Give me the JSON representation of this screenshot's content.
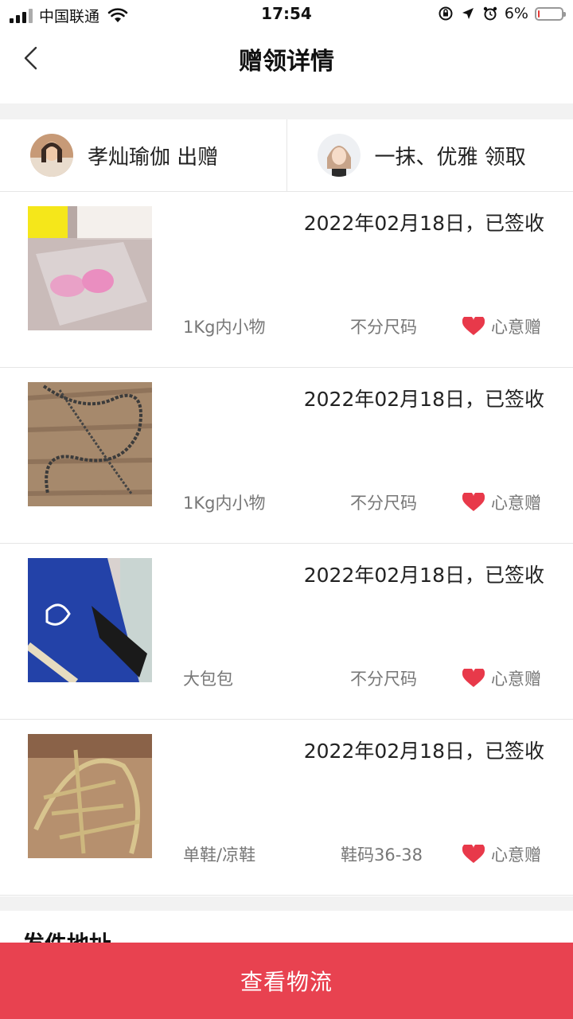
{
  "status_bar": {
    "carrier": "中国联通",
    "time": "17:54",
    "battery_percent": "6%",
    "battery_level": 0.06
  },
  "nav": {
    "title": "赠领详情",
    "back_icon": "chevron-left-icon"
  },
  "giver": {
    "name": "孝灿瑜伽 出赠"
  },
  "receiver": {
    "name": "一抹、优雅 领取"
  },
  "items": [
    {
      "date_status": "2022年02月18日，已签收",
      "weight": "1Kg内小物",
      "size": "不分尺码",
      "gift_type": "心意赠"
    },
    {
      "date_status": "2022年02月18日，已签收",
      "weight": "1Kg内小物",
      "size": "不分尺码",
      "gift_type": "心意赠"
    },
    {
      "date_status": "2022年02月18日，已签收",
      "weight": "大包包",
      "size": "不分尺码",
      "gift_type": "心意赠"
    },
    {
      "date_status": "2022年02月18日，已签收",
      "weight": "单鞋/凉鞋",
      "size": "鞋码36-38",
      "gift_type": "心意赠"
    }
  ],
  "section_title": "发件地址",
  "footer": {
    "button_label": "查看物流"
  },
  "colors": {
    "accent": "#e84250",
    "heart": "#e8394a"
  }
}
